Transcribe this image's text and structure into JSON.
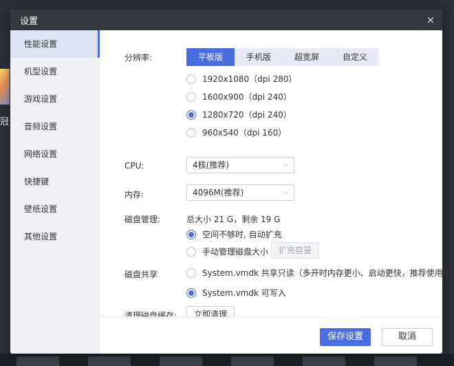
{
  "window": {
    "title": "设置",
    "close_icon": "×"
  },
  "background": {
    "partial_text": "冠亻"
  },
  "sidebar": {
    "items": [
      {
        "label": "性能设置",
        "active": true
      },
      {
        "label": "机型设置"
      },
      {
        "label": "游戏设置"
      },
      {
        "label": "音频设置"
      },
      {
        "label": "网络设置"
      },
      {
        "label": "快捷键"
      },
      {
        "label": "壁纸设置"
      },
      {
        "label": "其他设置"
      }
    ]
  },
  "resolution": {
    "label": "分辨率:",
    "tabs": [
      "平板版",
      "手机版",
      "超宽屏",
      "自定义"
    ],
    "active_tab": "平板版",
    "options": [
      "1920x1080（dpi 280）",
      "1600x900（dpi 240）",
      "1280x720（dpi 240）",
      "960x540（dpi 160）"
    ],
    "selected": "1280x720（dpi 240）"
  },
  "cpu": {
    "label": "CPU:",
    "value": "4核(推荐)"
  },
  "memory": {
    "label": "内存:",
    "value": "4096M(推荐)"
  },
  "disk_management": {
    "label": "磁盘管理:",
    "summary": "总大小 21 G，剩余 19 G",
    "options": [
      "空间不够时, 自动扩充",
      "手动管理磁盘大小"
    ],
    "selected": "空间不够时, 自动扩充",
    "expand_button": "扩充容量"
  },
  "disk_sharing": {
    "label": "磁盘共享",
    "options": [
      "System.vmdk 共享只读（多开时内存更小、启动更快，推荐使用）",
      "System.vmdk 可写入"
    ],
    "selected": "System.vmdk 可写入"
  },
  "clear_cache": {
    "label": "清理磁盘缓存:",
    "button": "立即清理"
  },
  "footer": {
    "save": "保存设置",
    "cancel": "取消"
  },
  "colors": {
    "accent": "#4a6ee0",
    "titlebar": "#33383f",
    "sidebar_bg": "#f0f1f4",
    "tab_bg": "#e8ebf6"
  }
}
